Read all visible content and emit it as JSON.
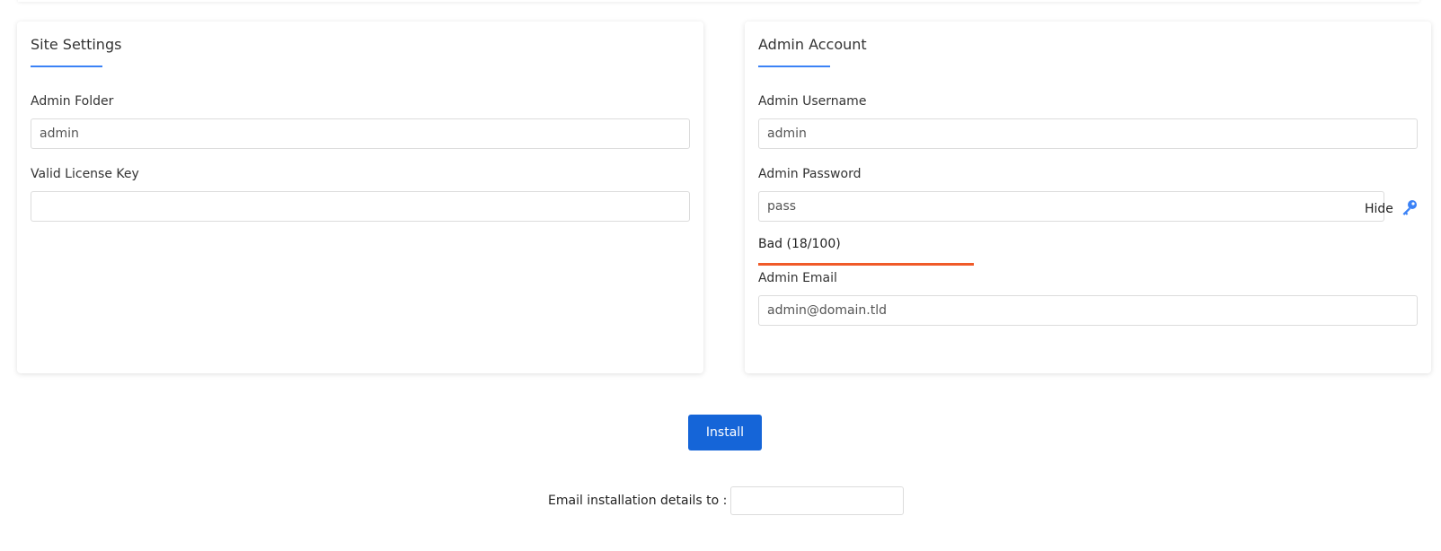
{
  "site_settings": {
    "title": "Site Settings",
    "admin_folder": {
      "label": "Admin Folder",
      "value": "admin"
    },
    "license_key": {
      "label": "Valid License Key",
      "value": ""
    }
  },
  "admin_account": {
    "title": "Admin Account",
    "username": {
      "label": "Admin Username",
      "value": "admin"
    },
    "password": {
      "label": "Admin Password",
      "value": "pass",
      "toggle_label": "Hide"
    },
    "strength": {
      "text": "Bad (18/100)",
      "score": 18,
      "color": "#f05a28"
    },
    "email": {
      "label": "Admin Email",
      "value": "admin@domain.tld"
    }
  },
  "actions": {
    "install_label": "Install",
    "email_details_label": "Email installation details to :",
    "email_details_value": ""
  },
  "colors": {
    "accent": "#3b82f6",
    "button": "#1565d8"
  },
  "icons": {
    "password_toggle": "key-icon"
  }
}
